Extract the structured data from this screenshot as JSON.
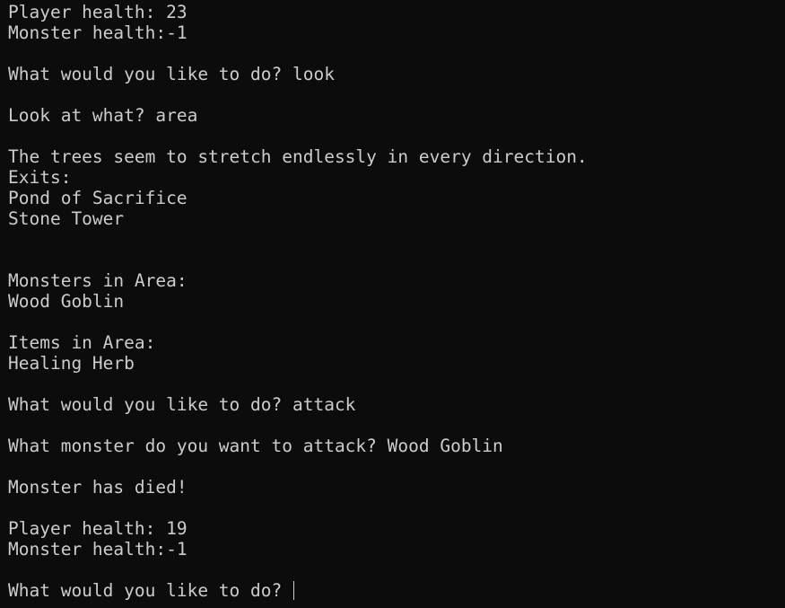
{
  "terminal": {
    "lines": [
      "Player health: 23",
      "Monster health:-1",
      "",
      "What would you like to do? look",
      "",
      "Look at what? area",
      "",
      "The trees seem to stretch endlessly in every direction.",
      "Exits:",
      "Pond of Sacrifice",
      "Stone Tower",
      "",
      "",
      "Monsters in Area:",
      "Wood Goblin",
      "",
      "Items in Area:",
      "Healing Herb",
      "",
      "What would you like to do? attack",
      "",
      "What monster do you want to attack? Wood Goblin",
      "",
      "Monster has died!",
      "",
      "Player health: 19",
      "Monster health:-1",
      ""
    ],
    "prompt": "What would you like to do? "
  }
}
